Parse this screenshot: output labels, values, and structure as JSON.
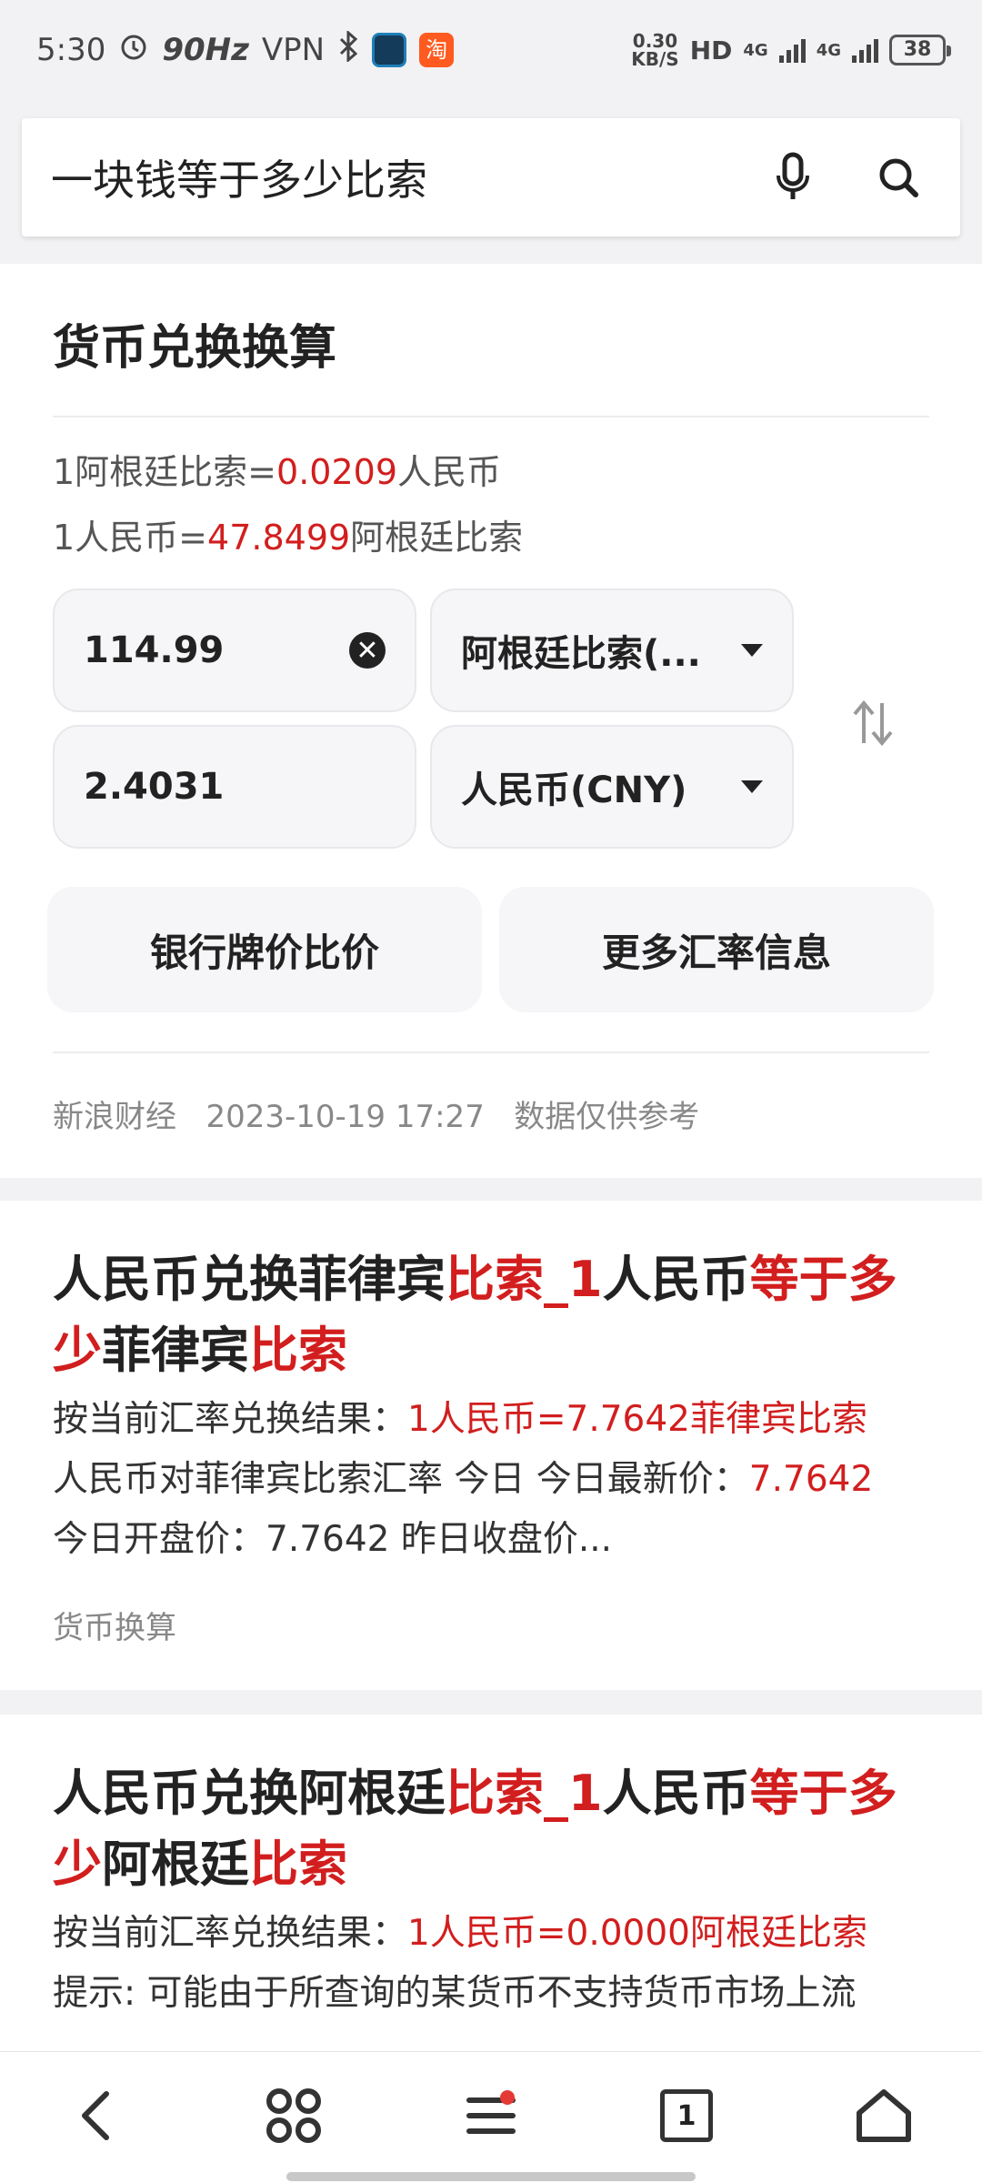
{
  "status_bar": {
    "time": "5:30",
    "refresh_rate": "90Hz",
    "vpn": "VPN",
    "app_icon_label": "淘",
    "net_speed_value": "0.30",
    "net_speed_unit": "KB/S",
    "hd": "HD",
    "network_1": "4G",
    "network_2": "4G",
    "battery": "38"
  },
  "search": {
    "query": "一块钱等于多少比索"
  },
  "converter": {
    "title": "货币兑换换算",
    "rate_line_1": {
      "prefix": "1阿根廷比索=",
      "value": "0.0209",
      "suffix": "人民币"
    },
    "rate_line_2": {
      "prefix": "1人民币=",
      "value": "47.8499",
      "suffix": "阿根廷比索"
    },
    "from_amount": "114.99",
    "from_currency": "阿根廷比索(...",
    "to_amount": "2.4031",
    "to_currency": "人民币(CNY)",
    "button_compare": "银行牌价比价",
    "button_more": "更多汇率信息",
    "source": "新浪财经",
    "timestamp": "2023-10-19 17:27",
    "disclaimer": "数据仅供参考"
  },
  "results": [
    {
      "title_parts": [
        {
          "text": "人民币兑换菲律宾",
          "hl": false
        },
        {
          "text": "比索",
          "hl": true
        },
        {
          "text": "_1",
          "hl": true
        },
        {
          "text": "人民币",
          "hl": false
        },
        {
          "text": "等于多少",
          "hl": true
        },
        {
          "text": "菲律宾",
          "hl": false
        },
        {
          "text": "比索",
          "hl": true
        }
      ],
      "line1_prefix": "按当前汇率兑换结果：",
      "line1_hl": "1人民币=7.7642菲律宾比索",
      "line2_prefix": "人民币对菲律宾比索汇率 今日 今日最新价：",
      "line2_hl": "7.7642",
      "line3": "今日开盘价：7.7642 昨日收盘价...",
      "tag": "货币换算"
    },
    {
      "title_parts": [
        {
          "text": "人民币兑换阿根廷",
          "hl": false
        },
        {
          "text": "比索",
          "hl": true
        },
        {
          "text": "_1",
          "hl": true
        },
        {
          "text": "人民币",
          "hl": false
        },
        {
          "text": "等于多少",
          "hl": true
        },
        {
          "text": "阿根廷",
          "hl": false
        },
        {
          "text": "比索",
          "hl": true
        }
      ],
      "line1_prefix": "按当前汇率兑换结果：",
      "line1_hl": "1人民币=0.0000阿根廷比索",
      "line2": "提示: 可能由于所查询的某货币不支持货币市场上流"
    }
  ],
  "bottom_nav": {
    "tab_count": "1"
  },
  "colors": {
    "highlight": "#d21e1e",
    "background": "#f2f2f4"
  }
}
